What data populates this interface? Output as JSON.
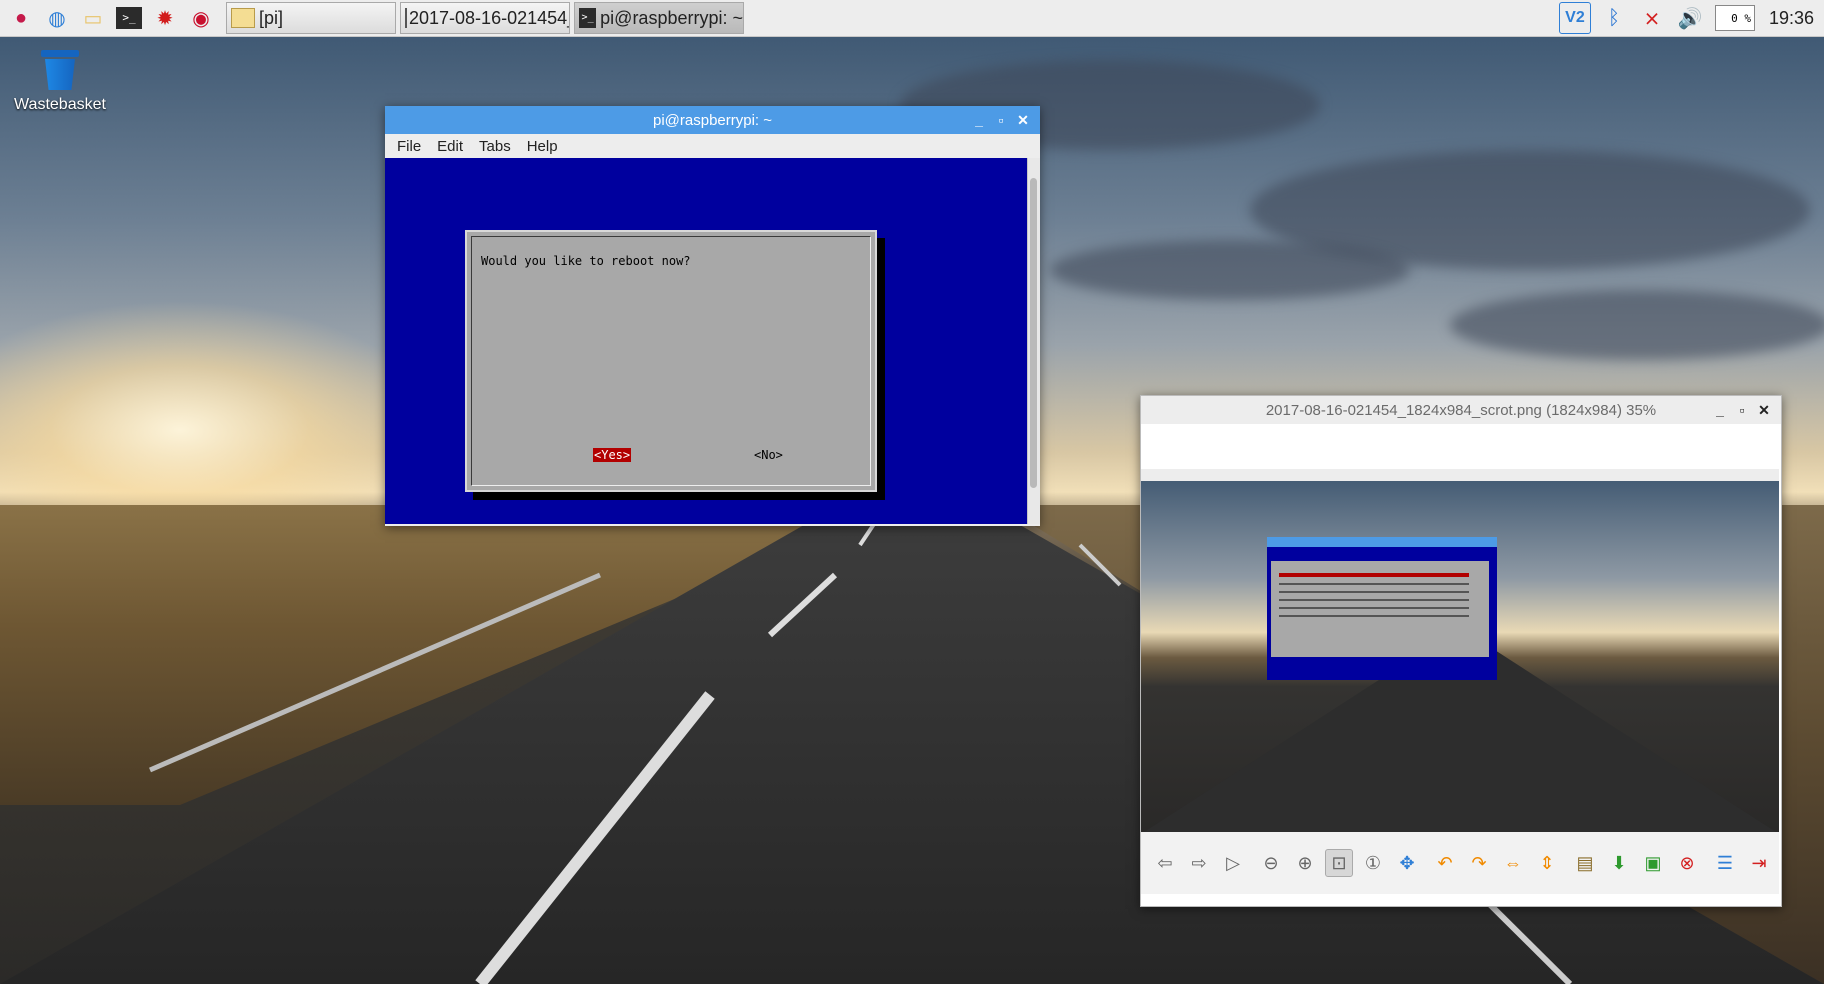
{
  "taskbar": {
    "launchers": [
      {
        "name": "raspberry-menu-icon",
        "glyph": "🍓"
      },
      {
        "name": "web-browser-icon",
        "glyph": "🌐"
      },
      {
        "name": "file-manager-icon",
        "glyph": "📁"
      },
      {
        "name": "terminal-icon",
        "glyph": ">_"
      },
      {
        "name": "mathematica-icon",
        "glyph": "✹"
      },
      {
        "name": "wolfram-icon",
        "glyph": "🐺"
      }
    ],
    "tasks": [
      {
        "label": "[pi]",
        "icon": "folder-icon"
      },
      {
        "label": "2017-08-16-021454_...",
        "icon": "image-icon"
      },
      {
        "label": "pi@raspberrypi: ~",
        "icon": "terminal-icon"
      }
    ],
    "tray": {
      "cpu": "0 %",
      "clock": "19:36"
    }
  },
  "desktop": {
    "wastebasket_label": "Wastebasket"
  },
  "terminal": {
    "title": "pi@raspberrypi: ~",
    "menu": [
      "File",
      "Edit",
      "Tabs",
      "Help"
    ],
    "dialog_text": "Would you like to reboot now?",
    "yes_label": "<Yes>",
    "no_label": "<No>"
  },
  "viewer": {
    "title": "2017-08-16-021454_1824x984_scrot.png (1824x984) 35%"
  },
  "colors": {
    "titlebar_active": "#4d9be6",
    "terminal_bg": "#00009e",
    "dialog_bg": "#a8a8a8",
    "selected_button": "#b20000"
  }
}
